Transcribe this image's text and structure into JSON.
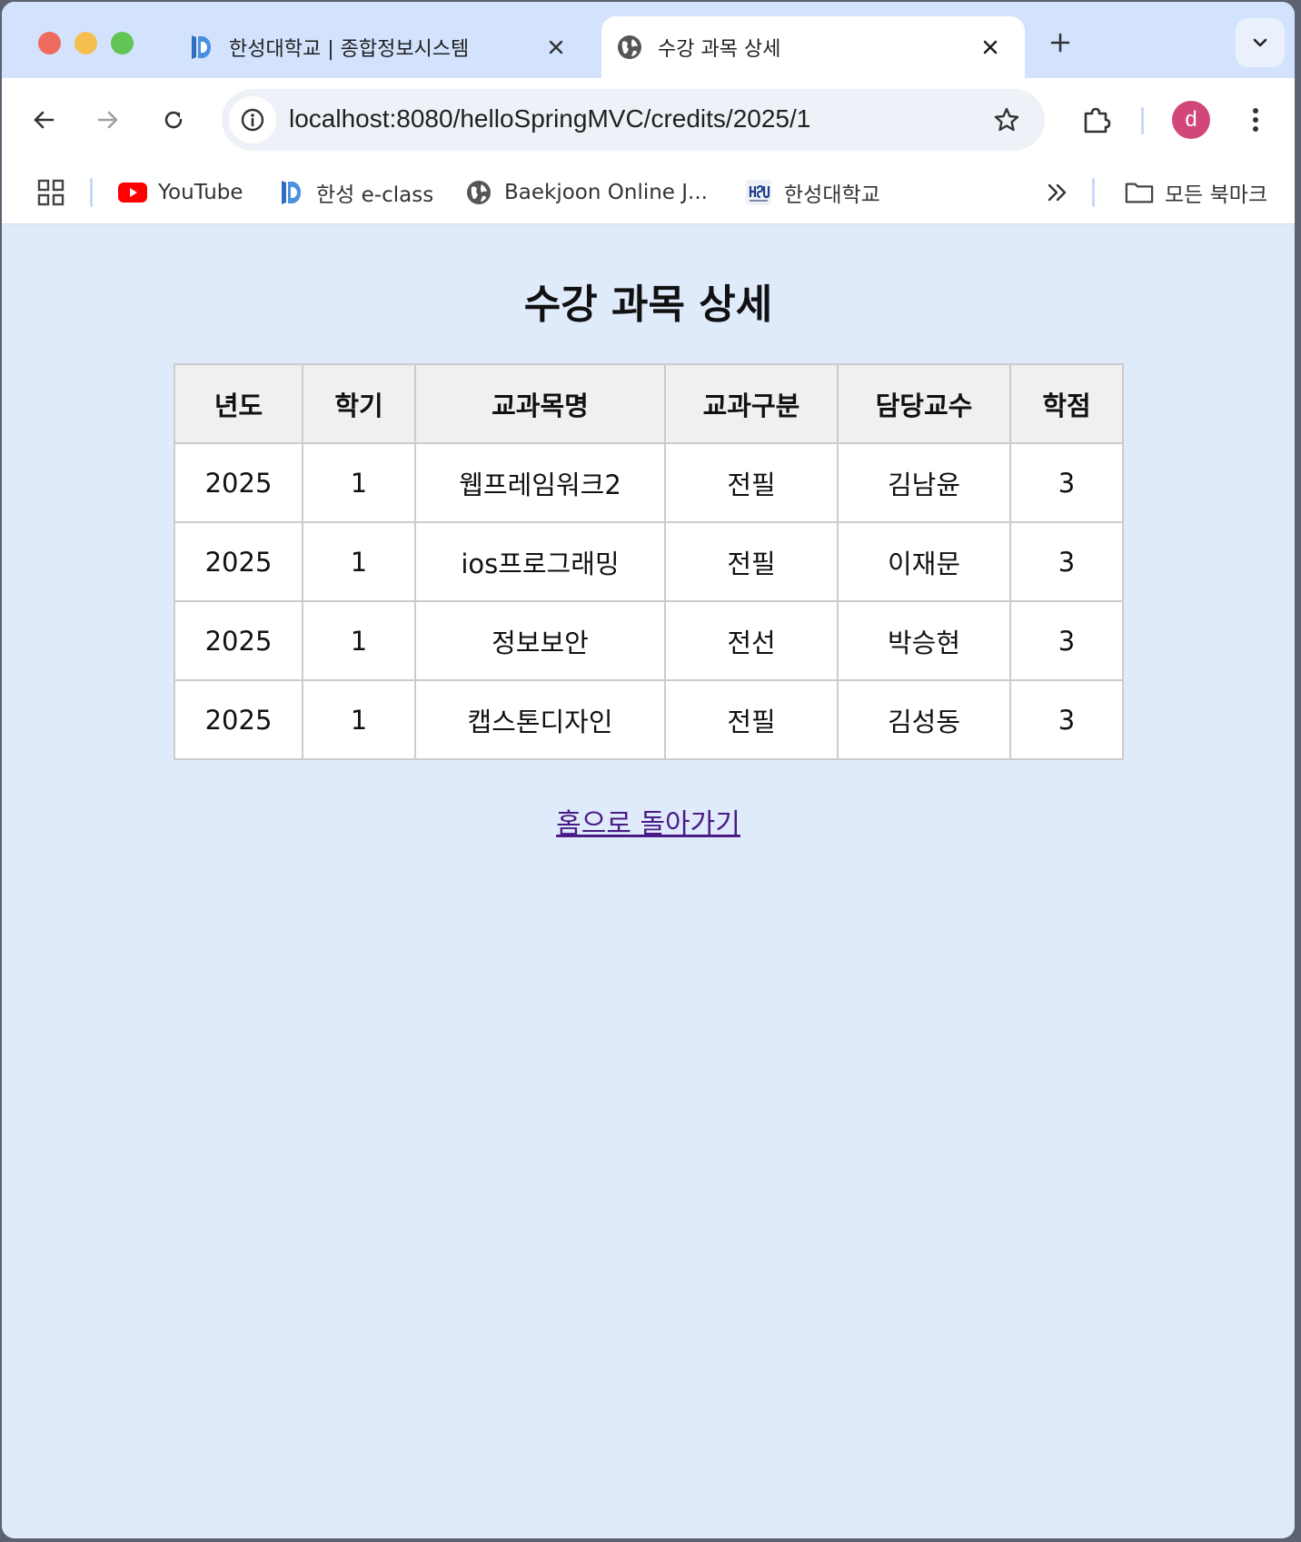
{
  "browser": {
    "tabs": [
      {
        "title": "한성대학교 | 종합정보시스템",
        "active": false,
        "icon": "hansung-logo-icon"
      },
      {
        "title": "수강 과목 상세",
        "active": true,
        "icon": "globe-icon"
      }
    ],
    "url": "localhost:8080/helloSpringMVC/credits/2025/1",
    "profile_initial": "d",
    "bookmarks": [
      {
        "label": "YouTube",
        "icon": "youtube-icon"
      },
      {
        "label": "한성 e-class",
        "icon": "hansung-logo-icon"
      },
      {
        "label": "Baekjoon Online J...",
        "icon": "globe-icon"
      },
      {
        "label": "한성대학교",
        "icon": "hsu-logo-icon"
      }
    ],
    "all_bookmarks_label": "모든 북마크",
    "colors": {
      "tabstrip": "#d3e3fd",
      "page_bg": "#dfeafb",
      "avatar": "#d1477a"
    }
  },
  "page": {
    "title": "수강 과목 상세",
    "table": {
      "headers": [
        "년도",
        "학기",
        "교과목명",
        "교과구분",
        "담당교수",
        "학점"
      ],
      "rows": [
        [
          "2025",
          "1",
          "웹프레임워크2",
          "전필",
          "김남윤",
          "3"
        ],
        [
          "2025",
          "1",
          "ios프로그래밍",
          "전필",
          "이재문",
          "3"
        ],
        [
          "2025",
          "1",
          "정보보안",
          "전선",
          "박승현",
          "3"
        ],
        [
          "2025",
          "1",
          "캡스톤디자인",
          "전필",
          "김성동",
          "3"
        ]
      ]
    },
    "home_link": "홈으로 돌아가기"
  }
}
